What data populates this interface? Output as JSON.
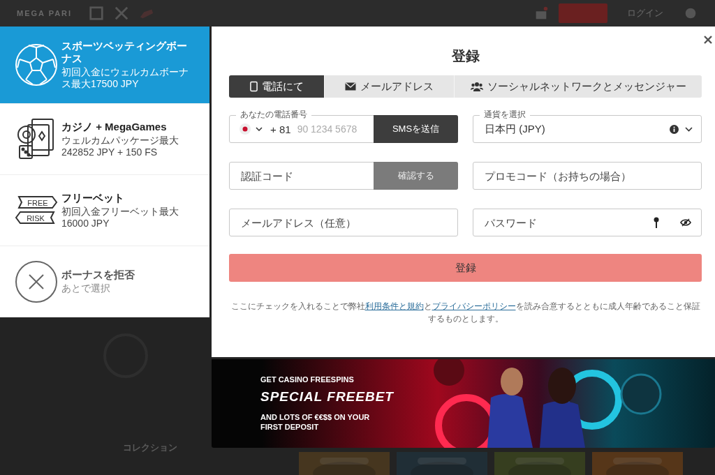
{
  "header": {
    "logo": "MEGA PARI",
    "login": "ログイン"
  },
  "bonuses": [
    {
      "kind": "sports",
      "title": "スポーツベッティングボーナス",
      "desc": "初回入金にウェルカムボーナス最大17500 JPY",
      "selected": true
    },
    {
      "kind": "casino",
      "title": "カジノ + MegaGames",
      "desc": "ウェルカムパッケージ最大 242852 JPY + 150 FS",
      "selected": false
    },
    {
      "kind": "freebet",
      "title": "フリーベット",
      "desc": "初回入金フリーベット最大 16000 JPY",
      "selected": false,
      "badges": [
        "FREE",
        "RISK"
      ]
    },
    {
      "kind": "decline",
      "title": "ボーナスを拒否",
      "desc": "あとで選択",
      "selected": false
    }
  ],
  "modal": {
    "title": "登録",
    "tabs": [
      {
        "kind": "phone",
        "label": "電話にて",
        "selected": true
      },
      {
        "kind": "mail",
        "label": "メールアドレス",
        "selected": false
      },
      {
        "kind": "social",
        "label": "ソーシャルネットワークとメッセンジャー",
        "selected": false
      }
    ],
    "phone": {
      "label": "あなたの電話番号",
      "code": "+ 81",
      "placeholder": "90 1234 5678",
      "button": "SMSを送信"
    },
    "currency": {
      "label": "通貨を選択",
      "value": "日本円 (JPY)"
    },
    "verify": {
      "placeholder": "認証コード",
      "button": "確認する",
      "disabled": true
    },
    "promo": {
      "placeholder": "プロモコード（お持ちの場合）"
    },
    "email": {
      "placeholder": "メールアドレス（任意）"
    },
    "password": {
      "placeholder": "パスワード"
    },
    "submit": "登録",
    "terms": {
      "text_1": "ここにチェックを入れることで弊社",
      "link_1": "利用条件と規約",
      "text_2": "と",
      "link_2": "プライバシーポリシー",
      "text_3": "を読み合意するとともに成人年齢であること保証するものとします。"
    }
  },
  "banner": {
    "kicker": "GET CASINO FREESPINS",
    "headline": "SPECIAL FREEBET",
    "text": "AND LOTS OF €€$$ ON YOUR FIRST DEPOSIT"
  },
  "background": {
    "collection": "コレクション"
  }
}
